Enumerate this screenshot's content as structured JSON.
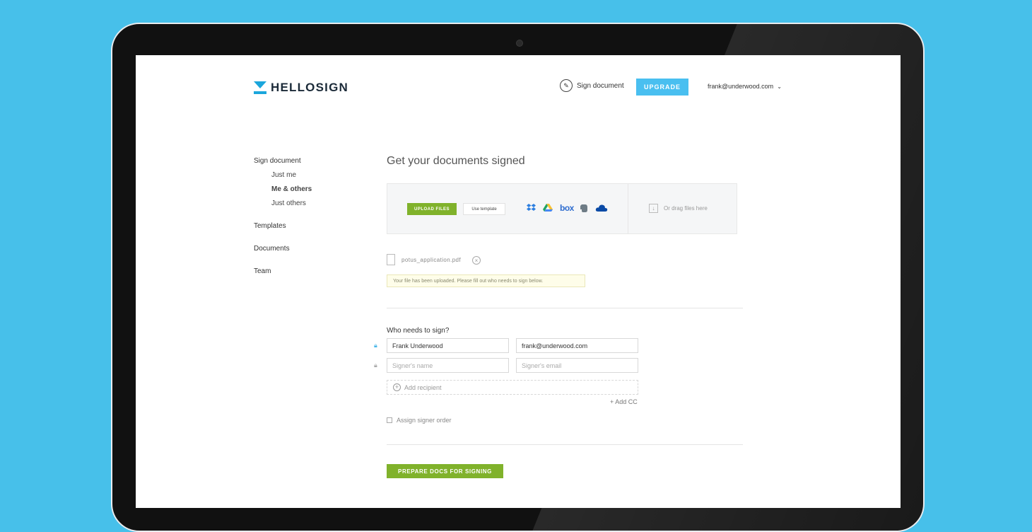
{
  "colors": {
    "background": "#47c0ea",
    "accent": "#49bff0",
    "green": "#80b22b",
    "brand": "#1ba6dc"
  },
  "header": {
    "logo_text": "HELLOSIGN",
    "sign_document_label": "Sign document",
    "upgrade_label": "UPGRADE",
    "user_email": "frank@underwood.com"
  },
  "sidebar": {
    "items": [
      {
        "label": "Sign document"
      },
      {
        "label": "Just me"
      },
      {
        "label": "Me & others"
      },
      {
        "label": "Just others"
      },
      {
        "label": "Templates"
      },
      {
        "label": "Documents"
      },
      {
        "label": "Team"
      }
    ]
  },
  "main": {
    "title": "Get your documents signed",
    "upload": {
      "upload_files_label": "UPLOAD FILES",
      "use_template_label": "Use template",
      "cloud_sources": [
        "dropbox-icon",
        "google-drive-icon",
        "box-icon",
        "evernote-icon",
        "onedrive-icon"
      ],
      "box_label": "box",
      "drag_label": "Or drag files here"
    },
    "file": {
      "name": "potus_application.pdf",
      "notice": "Your file has been uploaded. Please fill out who needs to sign below."
    },
    "signers": {
      "label": "Who needs to sign?",
      "rows": [
        {
          "name_value": "Frank Underwood",
          "email_value": "frank@underwood.com"
        },
        {
          "name_placeholder": "Signer's name",
          "email_placeholder": "Signer's email"
        }
      ],
      "add_recipient_label": "Add recipient",
      "add_cc_label": "+ Add CC",
      "assign_order_label": "Assign signer order"
    },
    "prepare_label": "PREPARE DOCS FOR SIGNING"
  }
}
